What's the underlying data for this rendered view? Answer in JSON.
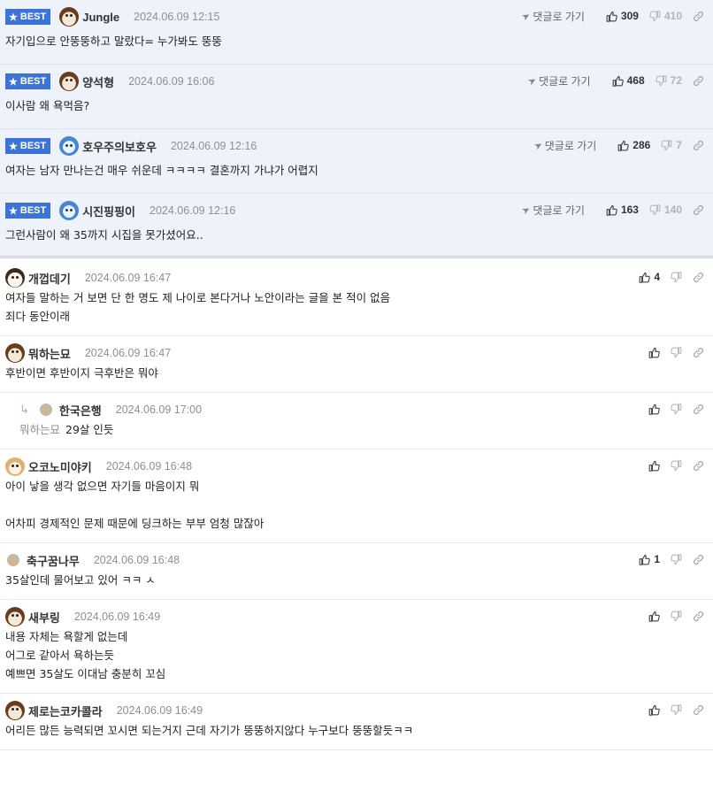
{
  "labels": {
    "best": "BEST",
    "goto": "댓글로 가기"
  },
  "icons": {
    "best_badge": "star-icon",
    "goto": "send-arrow-icon",
    "like": "thumbs-up-icon",
    "dislike": "thumbs-down-icon",
    "link": "link-icon",
    "reply": "reply-arrow-icon"
  },
  "colors": {
    "best_badge_bg": "#3b74d6",
    "best_row_bg": "#eef2fb"
  },
  "best_comments": [
    {
      "nick": "Jungle",
      "avatar": "dog",
      "date": "2024.06.09 12:15",
      "likes": "309",
      "dislikes": "410",
      "text": "자기입으로 안뚱뚱하고 말랐다= 누가봐도 뚱뚱"
    },
    {
      "nick": "양석형",
      "avatar": "dog",
      "date": "2024.06.09 16:06",
      "likes": "468",
      "dislikes": "72",
      "text": "이사람 왜 욕먹음?"
    },
    {
      "nick": "호우주의보호우",
      "avatar": "blue",
      "date": "2024.06.09 12:16",
      "likes": "286",
      "dislikes": "7",
      "text": "여자는 남자 만나는건 매우 쉬운데 ㅋㅋㅋㅋ 결혼까지 가냐가 어렵지"
    },
    {
      "nick": "시진핑핑이",
      "avatar": "blue",
      "date": "2024.06.09 12:16",
      "likes": "163",
      "dislikes": "140",
      "text": "그런사람이 왜 35까지 시집을 못가셨어요.."
    }
  ],
  "comments": [
    {
      "nick": "개껍데기",
      "avatar": "puppy",
      "date": "2024.06.09 16:47",
      "likes": "4",
      "dislikes": "",
      "lines": [
        "여자들 말하는 거 보면 단 한 명도 제 나이로 본다거나 노안이라는 글을 본 적이 없음",
        "죄다 동안이래"
      ]
    },
    {
      "nick": "뭐하는묘",
      "avatar": "dog",
      "date": "2024.06.09 16:47",
      "likes": "",
      "dislikes": "",
      "lines": [
        "후반이면 후반이지 극후반은 뭐야"
      ]
    },
    {
      "nick": "한국은행",
      "avatar": "beige",
      "date": "2024.06.09 17:00",
      "likes": "",
      "dislikes": "",
      "reply": true,
      "mention": "뭐하는묘",
      "lines": [
        "29살 인듯"
      ]
    },
    {
      "nick": "오코노미야키",
      "avatar": "fox",
      "date": "2024.06.09 16:48",
      "likes": "",
      "dislikes": "",
      "lines": [
        "아이 낳을 생각 없으면 자기들 마음이지 뭐",
        "",
        "어차피 경제적인 문제 때문에 딩크하는 부부 엄청 많잖아"
      ]
    },
    {
      "nick": "축구꿈나무",
      "avatar": "beige",
      "date": "2024.06.09 16:48",
      "likes": "1",
      "dislikes": "",
      "lines": [
        "35살인데 물어보고 있어 ㅋㅋ ㅅ"
      ]
    },
    {
      "nick": "새부링",
      "avatar": "dog",
      "date": "2024.06.09 16:49",
      "likes": "",
      "dislikes": "",
      "lines": [
        "내용 자체는 욕할게 없는데",
        "어그로 같아서 욕하는듯",
        "예쁘면 35살도 이대남 충분히 꼬심"
      ]
    },
    {
      "nick": "제로는코카콜라",
      "avatar": "dog",
      "date": "2024.06.09 16:49",
      "likes": "",
      "dislikes": "",
      "lines": [
        "어리든 많든 능력되면 꼬시면 되는거지 근데 자기가 뚱뚱하지않다 누구보다 뚱뚱할듯ㅋㅋ"
      ]
    }
  ]
}
